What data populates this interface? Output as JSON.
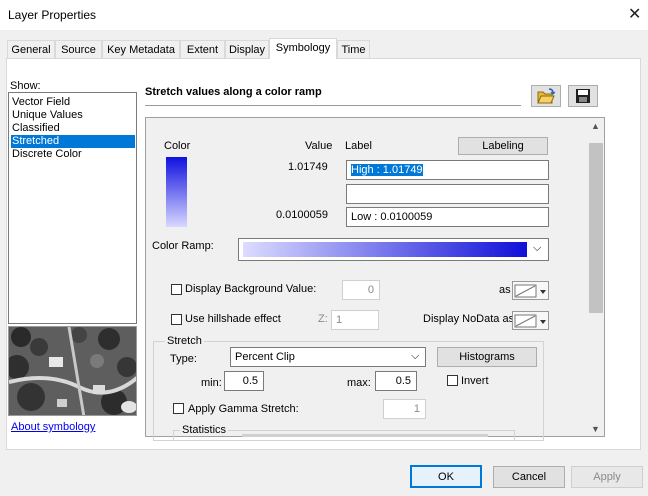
{
  "window": {
    "title": "Layer Properties",
    "close_glyph": "✕"
  },
  "tabs": [
    "General",
    "Source",
    "Key Metadata",
    "Extent",
    "Display",
    "Symbology",
    "Time"
  ],
  "active_tab": "Symbology",
  "show": {
    "label": "Show:",
    "items": [
      "Vector Field",
      "Unique Values",
      "Classified",
      "Stretched",
      "Discrete Color"
    ],
    "selected": "Stretched"
  },
  "about_link": "About symbology",
  "heading": "Stretch values along a color ramp",
  "icons": {
    "open": "folder-open-icon",
    "save": "save-disk-icon"
  },
  "legend": {
    "col_color": "Color",
    "col_value": "Value",
    "col_label": "Label",
    "labeling_button": "Labeling",
    "high_value": "1.01749",
    "high_label": "High : 1.01749",
    "mid_label": "",
    "low_value": "0.0100059",
    "low_label": "Low : 0.0100059",
    "ramp_top_color": "#1010e0",
    "ramp_bottom_color": "#d8d8ff"
  },
  "color_ramp": {
    "label": "Color Ramp:",
    "start_color": "#dcdcff",
    "end_color": "#1010d8"
  },
  "background": {
    "label": "Display Background Value:",
    "value": "0",
    "as_label": "as",
    "checked": false
  },
  "hillshade": {
    "label": "Use hillshade effect",
    "z_label": "Z:",
    "z_value": "1",
    "nodata_label": "Display NoData as",
    "checked": false
  },
  "stretch": {
    "group_label": "Stretch",
    "type_label": "Type:",
    "type_value": "Percent Clip",
    "histograms_button": "Histograms",
    "min_label": "min:",
    "min_value": "0.5",
    "max_label": "max:",
    "max_value": "0.5",
    "invert_label": "Invert",
    "invert_checked": false,
    "gamma_label": "Apply Gamma Stretch:",
    "gamma_value": "1",
    "gamma_checked": false,
    "statistics_label": "Statistics"
  },
  "buttons": {
    "ok": "OK",
    "cancel": "Cancel",
    "apply": "Apply"
  }
}
